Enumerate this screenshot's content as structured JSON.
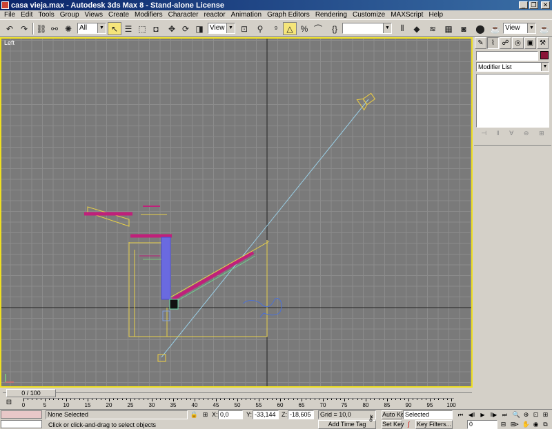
{
  "window": {
    "title": "casa vieja.max - Autodesk 3ds Max 8  - Stand-alone License",
    "minimize": "_",
    "restore": "❐",
    "close": "✕"
  },
  "menu": [
    "File",
    "Edit",
    "Tools",
    "Group",
    "Views",
    "Create",
    "Modifiers",
    "Character",
    "reactor",
    "Animation",
    "Graph Editors",
    "Rendering",
    "Customize",
    "MAXScript",
    "Help"
  ],
  "toolbar": {
    "selection_filter": "All",
    "ref_coord_system": "View",
    "named_selection": "",
    "render_view": "View"
  },
  "viewport": {
    "label": "Left",
    "background": "#7a7a7a",
    "border": "#f0e020"
  },
  "command_panel": {
    "object_name": "",
    "object_color": "#8a1538",
    "modifier_list": "Modifier List"
  },
  "time_slider": {
    "label": "0 / 100",
    "frame": 0,
    "end": 100
  },
  "track_ticks": [
    "0",
    "5",
    "10",
    "15",
    "20",
    "25",
    "30",
    "35",
    "40",
    "45",
    "50",
    "55",
    "60",
    "65",
    "70",
    "75",
    "80",
    "85",
    "90",
    "95",
    "100"
  ],
  "status": {
    "selection": "None Selected",
    "prompt": "Click or click-and-drag to select objects",
    "x_label": "X:",
    "x_value": "0,0",
    "y_label": "Y:",
    "y_value": "-33,144",
    "z_label": "Z:",
    "z_value": "-18,605",
    "grid": "Grid = 10,0",
    "add_time_tag": "Add Time Tag",
    "auto_key": "Auto Key",
    "set_key": "Set Key",
    "selected_dropdown": "Selected",
    "key_filters": "Key Filters...",
    "current_frame": "0"
  }
}
